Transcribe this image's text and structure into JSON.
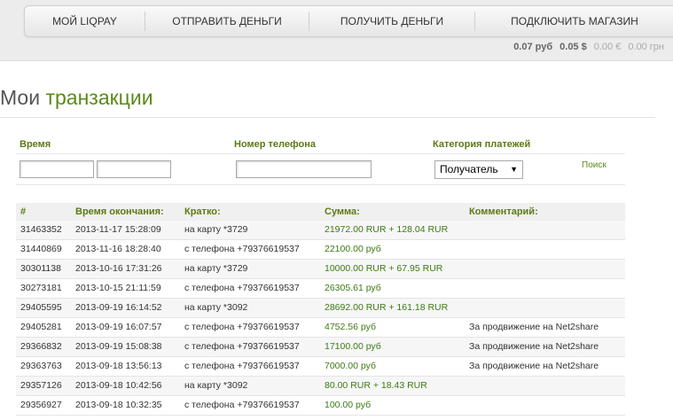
{
  "nav": {
    "items": [
      {
        "label": "МОЙ LIQPAY"
      },
      {
        "label": "ОТПРАВИТЬ ДЕНЬГИ"
      },
      {
        "label": "ПОЛУЧИТЬ ДЕНЬГИ"
      },
      {
        "label": "ПОДКЛЮЧИТЬ МАГАЗИН"
      }
    ]
  },
  "balances": {
    "rub": "0.07 руб",
    "usd": "0.05 $",
    "eur": "0.00 €",
    "uah": "0.00 грн"
  },
  "page": {
    "title_prefix": "Мои",
    "title_main": "транзакции"
  },
  "filters": {
    "time_label": "Время",
    "phone_label": "Номер телефона",
    "category_label": "Категория платежей",
    "time_from_value": "",
    "time_to_value": "",
    "phone_value": "",
    "category_selected": "Получатель",
    "search_label": "Поиск"
  },
  "table": {
    "columns": [
      "#",
      "Время окончания:",
      "Кратко:",
      "Сумма:",
      "Комментарий:"
    ],
    "rows": [
      {
        "id": "31463352",
        "time": "2013-11-17 15:28:09",
        "brief": "на карту *3729",
        "amount": "21972.00 RUR + 128.04 RUR",
        "comment": ""
      },
      {
        "id": "31440869",
        "time": "2013-11-16 18:28:40",
        "brief": "с телефона +79376619537",
        "amount": "22100.00 руб",
        "comment": ""
      },
      {
        "id": "30301138",
        "time": "2013-10-16 17:31:26",
        "brief": "на карту *3729",
        "amount": "10000.00 RUR + 67.95 RUR",
        "comment": ""
      },
      {
        "id": "30273181",
        "time": "2013-10-15 21:11:59",
        "brief": "с телефона +79376619537",
        "amount": "26305.61 руб",
        "comment": ""
      },
      {
        "id": "29405595",
        "time": "2013-09-19 16:14:52",
        "brief": "на карту *3092",
        "amount": "28692.00 RUR + 161.18 RUR",
        "comment": ""
      },
      {
        "id": "29405281",
        "time": "2013-09-19 16:07:57",
        "brief": "с телефона +79376619537",
        "amount": "4752.56 руб",
        "comment": "За продвижение на Net2share"
      },
      {
        "id": "29366832",
        "time": "2013-09-19 15:08:38",
        "brief": "с телефона +79376619537",
        "amount": "17100.00 руб",
        "comment": "За продвижение на Net2share"
      },
      {
        "id": "29363763",
        "time": "2013-09-18 13:56:13",
        "brief": "с телефона +79376619537",
        "amount": "7000.00 руб",
        "comment": "За продвижение на Net2share"
      },
      {
        "id": "29357126",
        "time": "2013-09-18 10:42:56",
        "brief": "на карту *3092",
        "amount": "80.00 RUR + 18.43 RUR",
        "comment": ""
      },
      {
        "id": "29356927",
        "time": "2013-09-18 10:32:35",
        "brief": "с телефона +79376619537",
        "amount": "100.00 руб",
        "comment": ""
      }
    ]
  },
  "colors": {
    "accent_green": "#5b8a19",
    "label_green": "#5b7a14",
    "amount_green": "#3d7a14"
  }
}
